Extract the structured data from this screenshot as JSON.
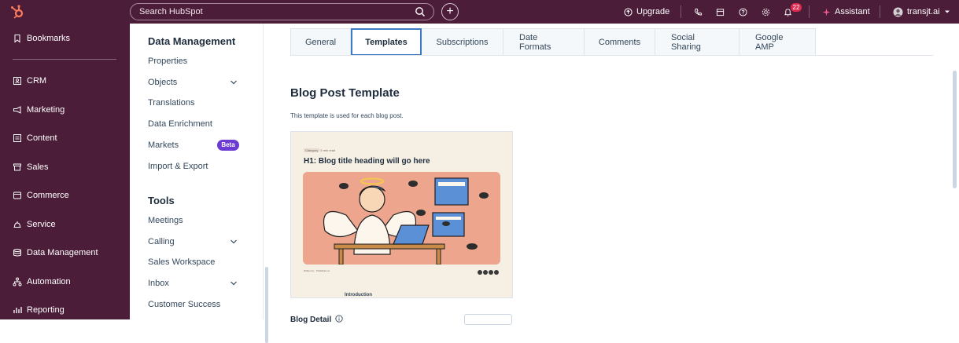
{
  "topbar": {
    "search_placeholder": "Search HubSpot",
    "upgrade_label": "Upgrade",
    "notification_count": "22",
    "assistant_label": "Assistant",
    "account_label": "transjt.ai"
  },
  "sidebar": {
    "items": [
      {
        "label": "Bookmarks",
        "icon": "bookmark-icon"
      },
      {
        "label": "CRM",
        "icon": "crm-icon"
      },
      {
        "label": "Marketing",
        "icon": "megaphone-icon"
      },
      {
        "label": "Content",
        "icon": "content-icon"
      },
      {
        "label": "Sales",
        "icon": "sales-icon"
      },
      {
        "label": "Commerce",
        "icon": "commerce-icon"
      },
      {
        "label": "Service",
        "icon": "service-icon"
      },
      {
        "label": "Data Management",
        "icon": "database-icon"
      },
      {
        "label": "Automation",
        "icon": "automation-icon"
      },
      {
        "label": "Reporting",
        "icon": "reporting-icon"
      }
    ]
  },
  "subnav": {
    "data_management_heading": "Data Management",
    "data_management_items": [
      "Properties",
      "Objects",
      "Translations",
      "Data Enrichment",
      "Markets",
      "Import & Export"
    ],
    "beta_label": "Beta",
    "tools_heading": "Tools",
    "tools_items": [
      "Meetings",
      "Calling",
      "Sales Workspace",
      "Inbox",
      "Customer Success"
    ]
  },
  "tabs": [
    {
      "label": "General",
      "active": false
    },
    {
      "label": "Templates",
      "active": true
    },
    {
      "label": "Subscriptions",
      "active": false
    },
    {
      "label": "Date Formats",
      "active": false
    },
    {
      "label": "Comments",
      "active": false
    },
    {
      "label": "Social Sharing",
      "active": false
    },
    {
      "label": "Google AMP",
      "active": false
    }
  ],
  "section": {
    "title": "Blog Post Template",
    "description": "This template is used for each blog post.",
    "blog_detail_label": "Blog Detail"
  },
  "preview": {
    "chip": "Category",
    "chip_sub": "5 min read",
    "heading": "H1: Blog title heading will go here",
    "meta_left": "Written by",
    "meta_right": "Published on",
    "intro": "Introduction"
  },
  "colors": {
    "topbar_bg": "#4b1d38",
    "active_tab_border": "#3d7cc4",
    "beta_badge": "#6b3bd4",
    "notification_badge": "#e0294f",
    "preview_image_bg": "#eea58e"
  }
}
